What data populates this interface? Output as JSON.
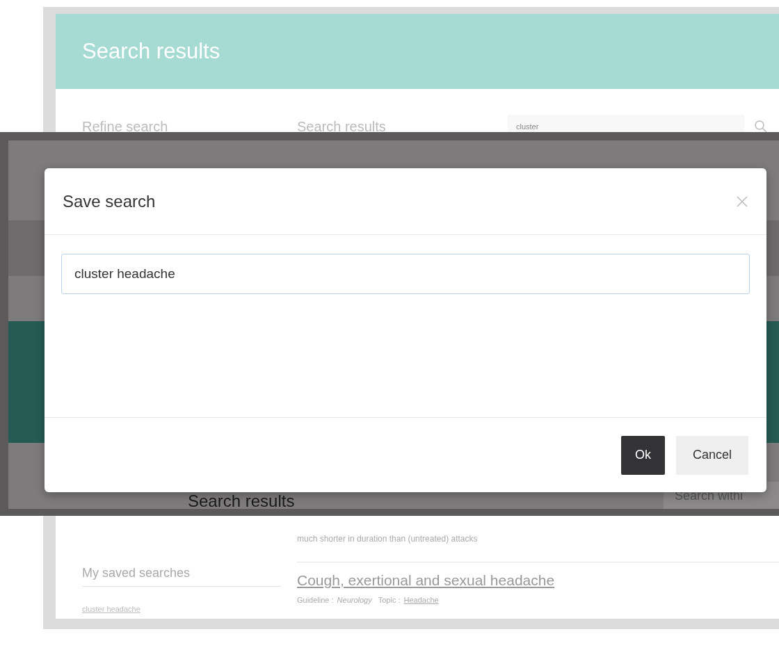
{
  "page": {
    "title": "Search results"
  },
  "toolbar": {
    "sidebar_heading": "Refine search",
    "results_heading": "Search results",
    "search": {
      "value": "cluster"
    }
  },
  "background_screen": {
    "heading": "Search results",
    "search_placeholder": "Search withi"
  },
  "dialog": {
    "title": "Save search",
    "input_value": "cluster headache",
    "buttons": [
      {
        "label": "Ok",
        "kind": "primary"
      },
      {
        "label": "Cancel",
        "kind": "secondary"
      }
    ]
  },
  "sidebar": {
    "saved_heading": "My saved searches",
    "saved_items": [
      "cluster headache"
    ]
  },
  "results": {
    "snippet": "much shorter in duration than (untreated) attacks",
    "items": [
      {
        "title": "Cough, exertional and sexual headache",
        "type_label": "Guideline :",
        "type_value": "Neurology",
        "topic_label": "Topic :",
        "topic_link": "Headache"
      }
    ]
  }
}
